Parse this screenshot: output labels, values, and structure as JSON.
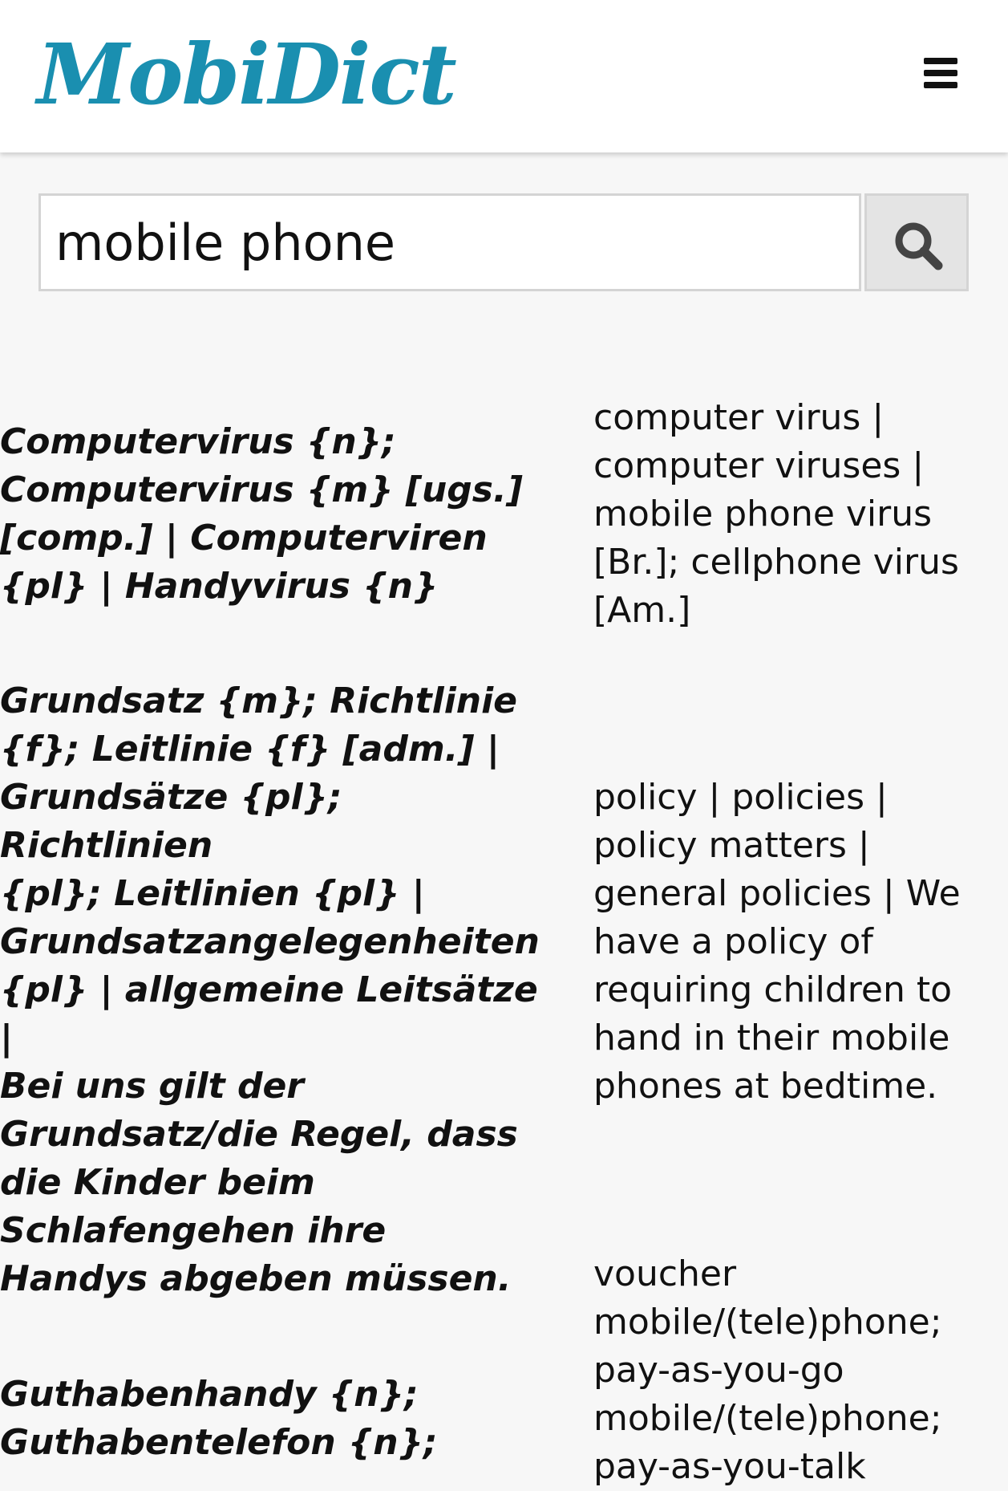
{
  "header": {
    "logo": "MobiDict"
  },
  "search": {
    "value": "mobile phone"
  },
  "entries": [
    {
      "german": "Computervirus {n};\nComputervirus {m} [ugs.]\n[comp.] | Computerviren\n{pl} | Handyvirus {n}",
      "english": "computer virus |\ncomputer viruses |\nmobile phone virus\n[Br.]; cellphone virus\n[Am.]"
    },
    {
      "german": "Grundsatz {m}; Richtlinie\n{f}; Leitlinie {f} [adm.] |\nGrundsätze {pl}; Richtlinien\n{pl}; Leitlinien {pl} |\nGrundsatzangelegenheiten\n{pl} | allgemeine Leitsätze |\nBei uns gilt der\nGrundsatz/die Regel, dass\ndie Kinder beim\nSchlafengehen ihre\nHandys abgeben müssen.",
      "english": "policy | policies |\npolicy matters |\ngeneral policies | We\nhave a policy of\nrequiring children to\nhand in their mobile\nphones at bedtime."
    },
    {
      "german": "Guthabenhandy {n};\nGuthabentelefon {n};",
      "english": "voucher\nmobile/(tele)phone;\npay-as-you-go\nmobile/(tele)phone;\npay-as-you-talk"
    }
  ]
}
